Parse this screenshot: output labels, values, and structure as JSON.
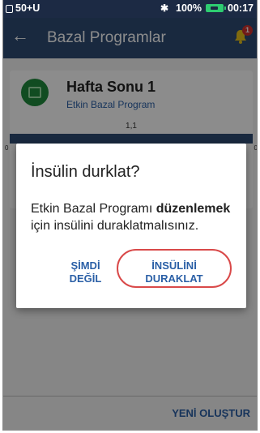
{
  "statusbar": {
    "left_text": "50+U",
    "battery_percent": "100%",
    "time": "00:17",
    "lock_icon": "lock-icon",
    "bluetooth_icon": "bluetooth-icon",
    "battery_icon": "battery-icon"
  },
  "header": {
    "title": "Bazal Programlar",
    "back_icon": "arrow-left-icon",
    "bell_icon": "bell-icon",
    "notification_count": "1"
  },
  "program_card": {
    "title": "Hafta Sonu 1",
    "subtitle": "Etkin Bazal Program",
    "rate": "1,1",
    "axis_start": "0",
    "axis_end": "0"
  },
  "dialog": {
    "title": "İnsülin durklat?",
    "body_before": "Etkin Bazal Programı ",
    "body_bold": "düzenlemek",
    "body_after": " için insülini duraklatmalısınız.",
    "cancel_line1": "ŞİMDİ",
    "cancel_line2": "DEĞİL",
    "confirm_line1": "İNSÜLİNİ",
    "confirm_line2": "DURAKLAT"
  },
  "bottom": {
    "create_new": "YENİ OLUŞTUR"
  },
  "colors": {
    "statusbar": "#1c2a44",
    "header": "#2e4b74",
    "accent_text": "#2a5fa6",
    "highlight_ring": "#d94949",
    "badge": "#d0312d",
    "calendar_circle": "#1f8a3d"
  }
}
